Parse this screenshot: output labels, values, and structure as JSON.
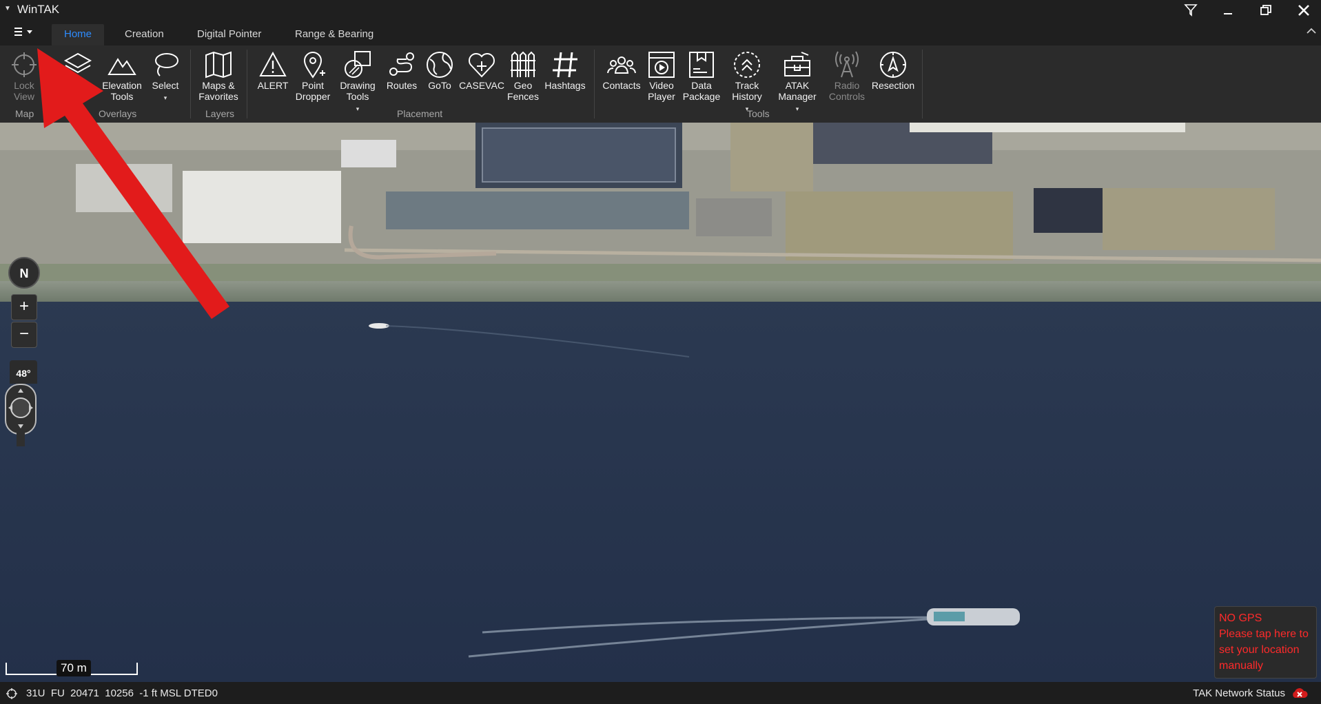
{
  "app": {
    "title": "WinTAK"
  },
  "window_controls": {
    "filter": "filter-icon",
    "minimize": "—",
    "restore": "restore-icon",
    "close": "✕"
  },
  "tabs": [
    {
      "label": "Home",
      "active": true
    },
    {
      "label": "Creation",
      "active": false
    },
    {
      "label": "Digital Pointer",
      "active": false
    },
    {
      "label": "Range & Bearing",
      "active": false
    }
  ],
  "ribbon": {
    "buttons": {
      "lock_view": "Lock\nView",
      "layers": "",
      "elevation_tools": "Elevation\nTools",
      "select": "Select",
      "maps_favorites": "Maps &\nFavorites",
      "alert": "ALERT",
      "point_dropper": "Point\nDropper",
      "drawing_tools": "Drawing\nTools",
      "routes": "Routes",
      "goto": "GoTo",
      "casevac": "CASEVAC",
      "geo_fences": "Geo\nFences",
      "hashtags": "Hashtags",
      "contacts": "Contacts",
      "video_player": "Video\nPlayer",
      "data_package": "Data\nPackage",
      "track_history": "Track\nHistory",
      "atak_manager": "ATAK\nManager",
      "radio_controls": "Radio\nControls",
      "resection": "Resection"
    },
    "groups": {
      "map": "Map",
      "overlays": "Overlays",
      "layers": "Layers",
      "placement": "Placement",
      "tools": "Tools"
    }
  },
  "map": {
    "compass_label": "N",
    "zoom_in": "+",
    "zoom_out": "−",
    "tilt": "48°",
    "scale": "70 m",
    "no_gps": {
      "title": "NO GPS",
      "message": "Please tap here to set your location manually"
    }
  },
  "status": {
    "coordinates": "31U  FU  20471  10256  -1 ft MSL DTED0",
    "network": "TAK Network Status"
  },
  "colors": {
    "accent": "#2d8cff",
    "alert": "#ff2a2a",
    "annotation_arrow": "#e21b1b"
  }
}
